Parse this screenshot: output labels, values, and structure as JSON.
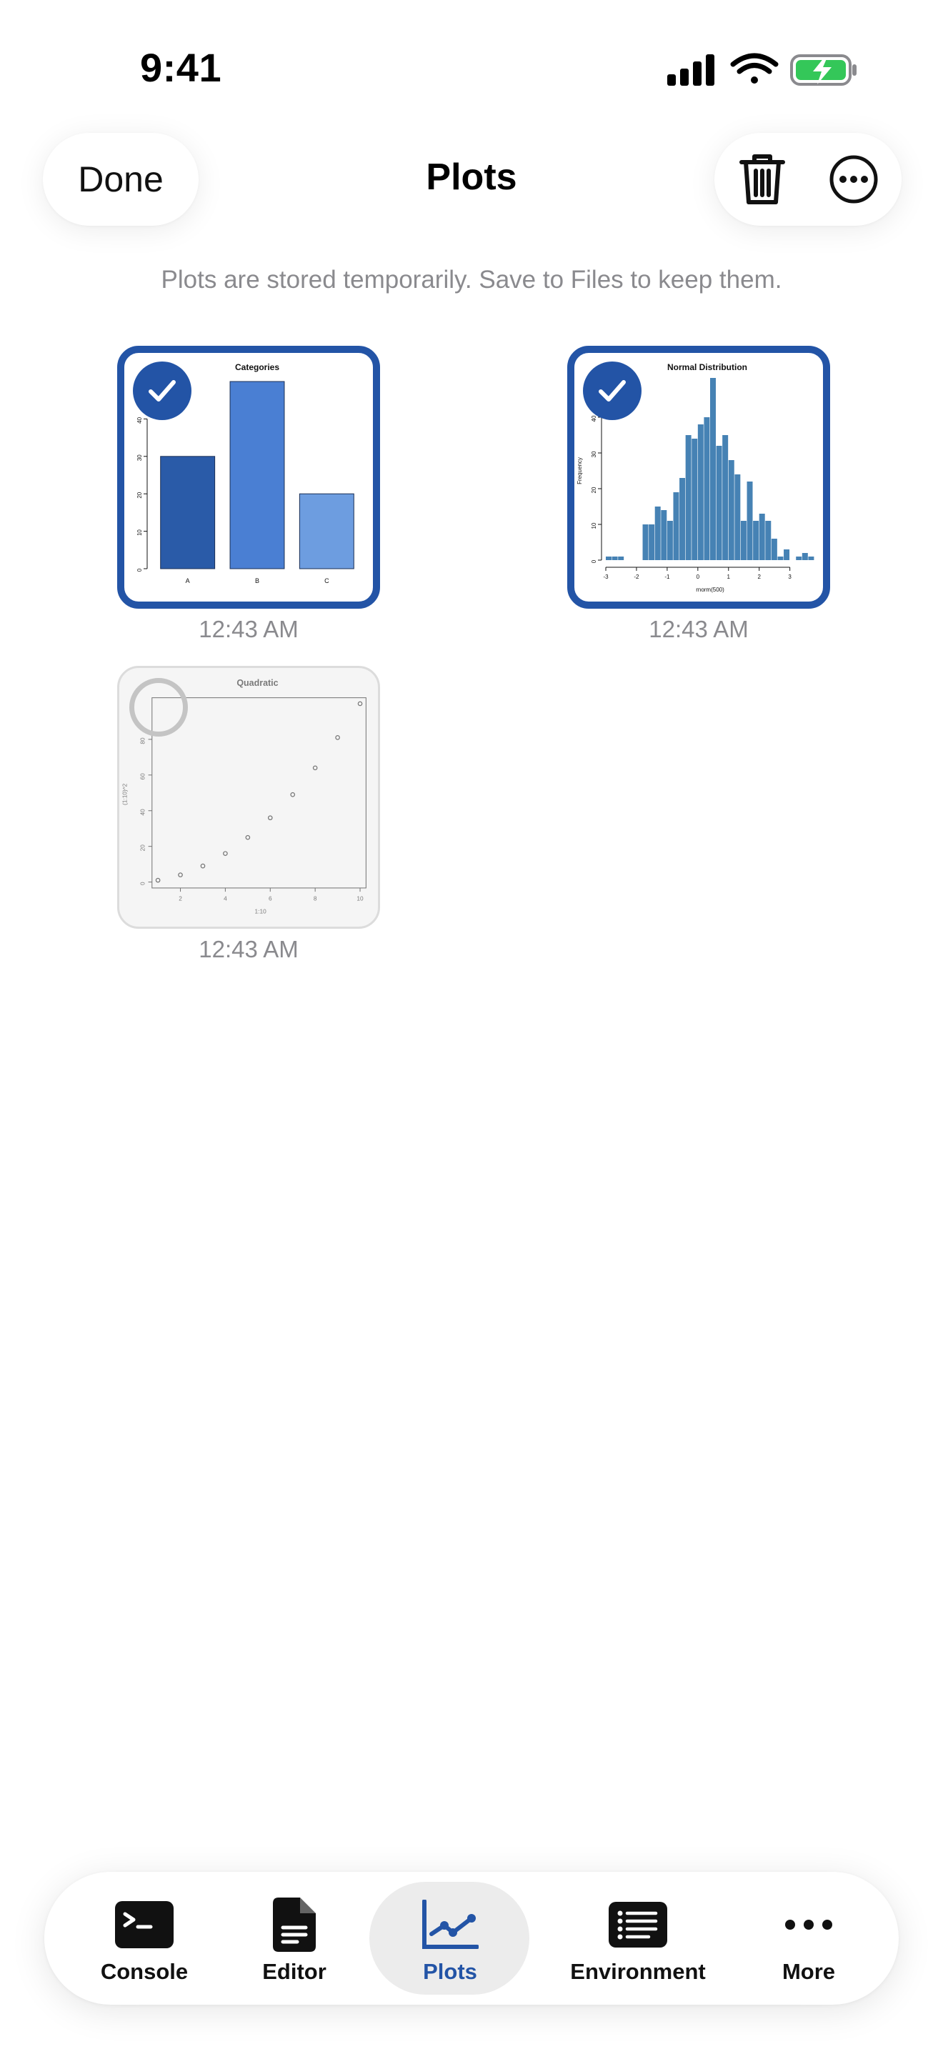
{
  "status": {
    "time": "9:41"
  },
  "header": {
    "done_label": "Done",
    "title": "Plots"
  },
  "notice": "Plots are stored temporarily. Save to Files to keep them.",
  "plots": [
    {
      "timestamp": "12:43 AM",
      "selected": true,
      "chart_data": {
        "type": "bar",
        "title": "Categories",
        "categories": [
          "A",
          "B",
          "C"
        ],
        "values": [
          30,
          50,
          20
        ],
        "colors": [
          "#2a5ba8",
          "#4a7fd3",
          "#6d9de0"
        ],
        "ylim": [
          0,
          50
        ],
        "yticks": [
          "0",
          "10",
          "20",
          "30",
          "40"
        ]
      }
    },
    {
      "timestamp": "12:43 AM",
      "selected": true,
      "chart_data": {
        "type": "bar",
        "title": "Normal Distribution",
        "xlabel": "rnorm(500)",
        "ylabel": "Frequency",
        "bin_start": -3,
        "bin_width": 0.2,
        "values": [
          1,
          1,
          1,
          0,
          0,
          0,
          10,
          10,
          15,
          14,
          11,
          19,
          23,
          35,
          34,
          38,
          40,
          51,
          32,
          35,
          28,
          24,
          11,
          22,
          11,
          13,
          11,
          6,
          1,
          3,
          0,
          1,
          2,
          1
        ],
        "ylim": [
          0,
          50
        ],
        "xticks": [
          "-3",
          "-2",
          "-1",
          "0",
          "1",
          "2",
          "3"
        ],
        "yticks": [
          "0",
          "10",
          "20",
          "30",
          "40"
        ],
        "color": "#4682b4"
      }
    },
    {
      "timestamp": "12:43 AM",
      "selected": false,
      "chart_data": {
        "type": "scatter",
        "title": "Quadratic",
        "xlabel": "1:10",
        "ylabel": "(1:10)^2",
        "x": [
          1,
          2,
          3,
          4,
          5,
          6,
          7,
          8,
          9,
          10
        ],
        "y": [
          1,
          4,
          9,
          16,
          25,
          36,
          49,
          64,
          81,
          100
        ],
        "xlim": [
          1,
          10
        ],
        "ylim": [
          0,
          100
        ],
        "xticks": [
          "2",
          "4",
          "6",
          "8",
          "10"
        ],
        "yticks": [
          "0",
          "20",
          "40",
          "60",
          "80"
        ]
      }
    }
  ],
  "tabs": [
    {
      "label": "Console",
      "icon": "console-icon"
    },
    {
      "label": "Editor",
      "icon": "document-icon"
    },
    {
      "label": "Plots",
      "icon": "chart-line-icon",
      "active": true
    },
    {
      "label": "Environment",
      "icon": "list-icon"
    },
    {
      "label": "More",
      "icon": "ellipsis-icon"
    }
  ],
  "colors": {
    "accent": "#2354a6",
    "secondary_text": "#8a8a8e",
    "battery_green": "#34c759"
  }
}
